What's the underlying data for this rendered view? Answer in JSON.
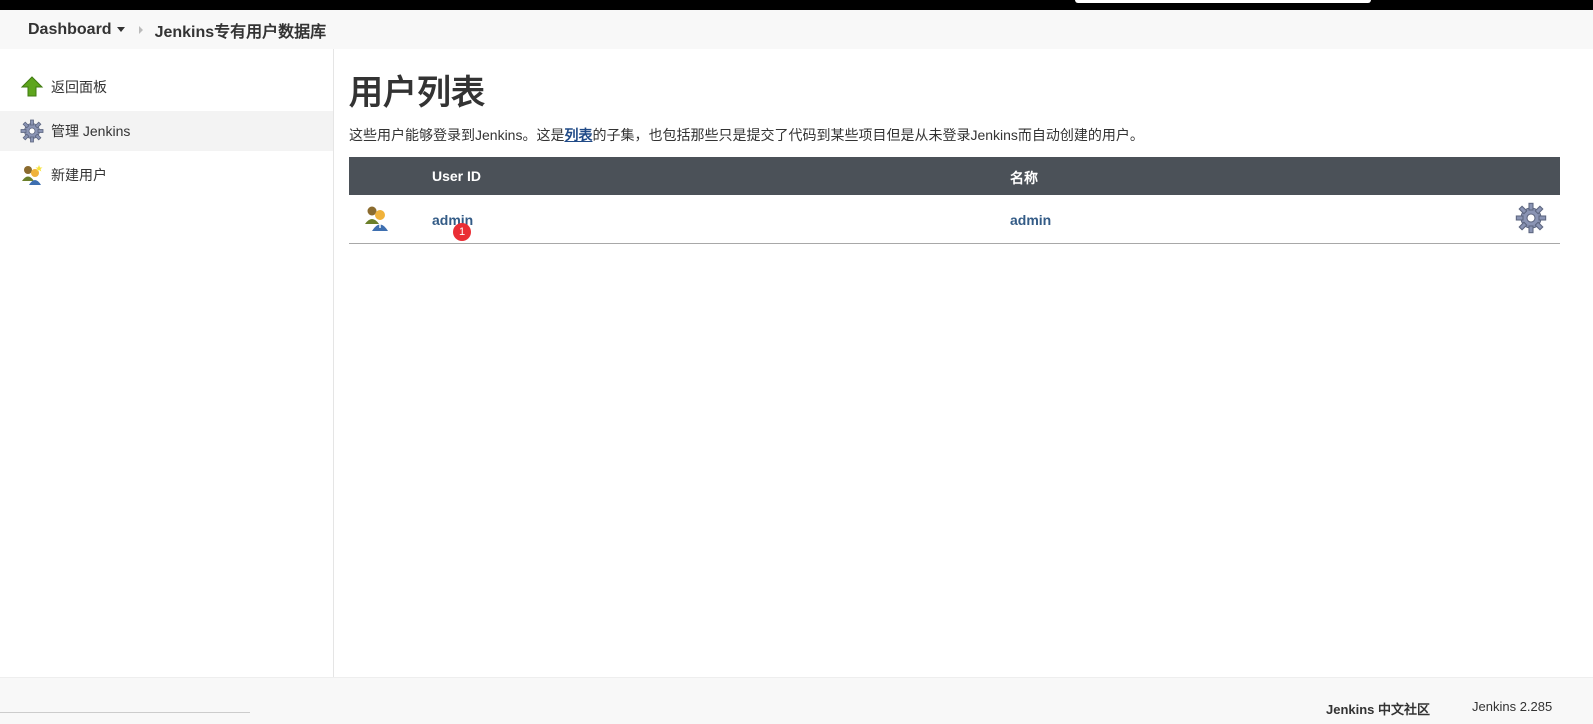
{
  "breadcrumb": {
    "dashboard": "Dashboard",
    "current": "Jenkins专有用户数据库"
  },
  "sidebar": {
    "items": [
      {
        "label": "返回面板",
        "icon": "up-arrow-icon"
      },
      {
        "label": "管理 Jenkins",
        "icon": "gear-icon"
      },
      {
        "label": "新建用户",
        "icon": "new-user-icon"
      }
    ]
  },
  "main": {
    "title": "用户列表",
    "desc_before": "这些用户能够登录到Jenkins。这是",
    "desc_link": "列表",
    "desc_after": "的子集，也包括那些只是提交了代码到某些项目但是从未登录Jenkins而自动创建的用户。"
  },
  "table": {
    "headers": {
      "user_id": "User ID",
      "name": "名称"
    },
    "rows": [
      {
        "user_id": "admin",
        "name": "admin",
        "badge": "1"
      }
    ]
  },
  "footer": {
    "community": "Jenkins 中文社区",
    "version": "Jenkins 2.285"
  },
  "colors": {
    "header_bg": "#4b5158",
    "link": "#335b86",
    "badge": "#ea2e35",
    "up_arrow": "#5ea51d"
  }
}
